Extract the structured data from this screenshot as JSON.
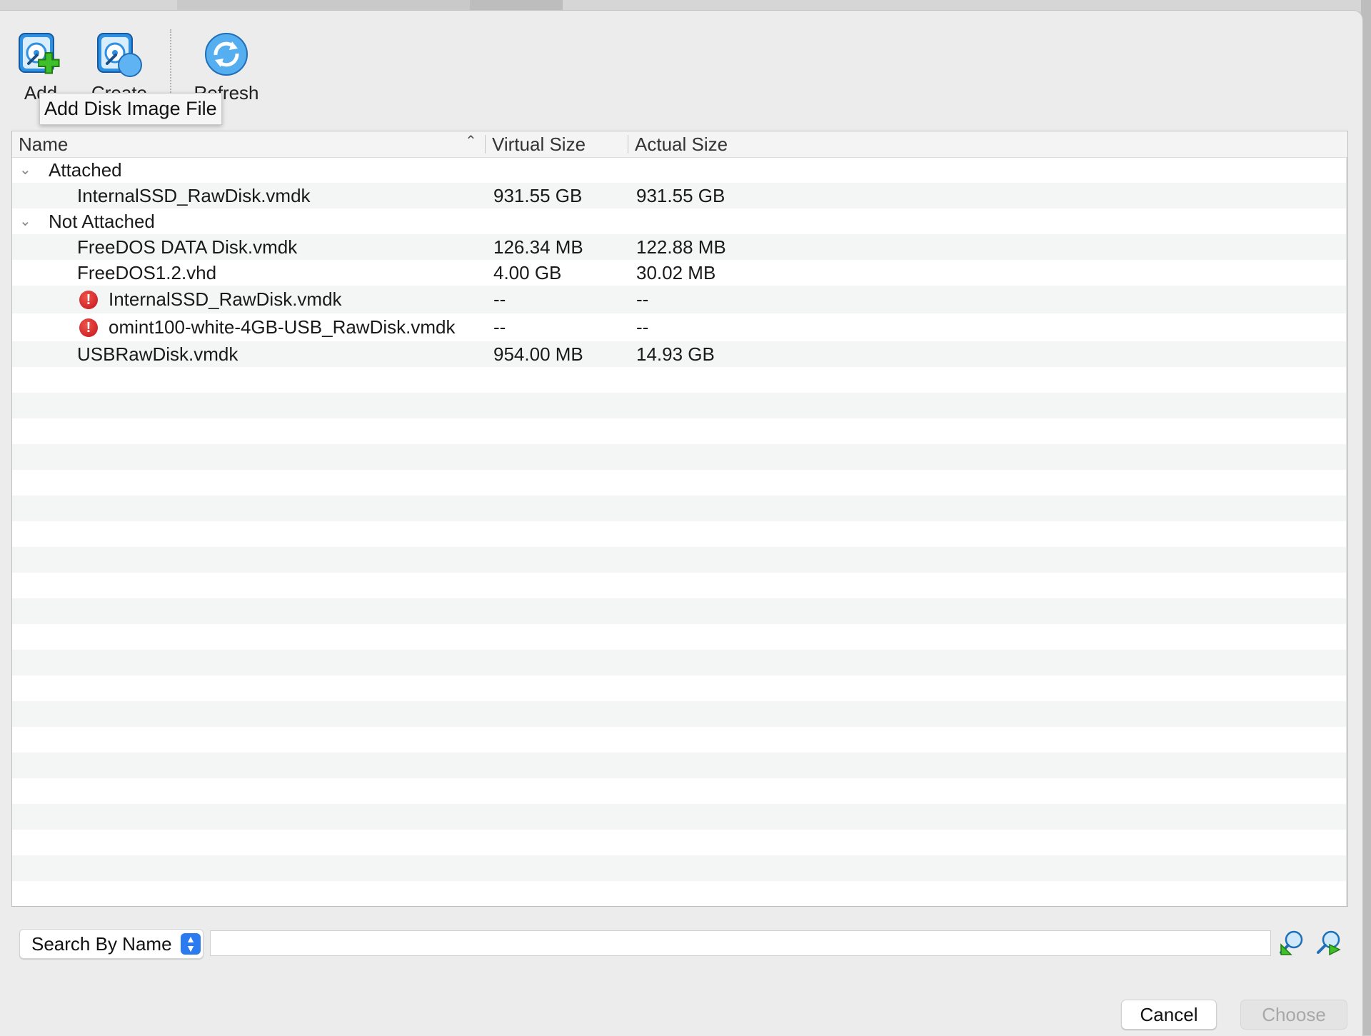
{
  "toolbar": {
    "add_label": "Add",
    "create_label": "Create",
    "refresh_label": "Refresh"
  },
  "tooltip": "Add Disk Image File",
  "table": {
    "columns": [
      "Name",
      "Virtual Size",
      "Actual Size"
    ],
    "groups": [
      {
        "label": "Attached",
        "items": [
          {
            "name": "InternalSSD_RawDisk.vmdk",
            "virtual": "931.55 GB",
            "actual": "931.55 GB",
            "error": false
          }
        ]
      },
      {
        "label": "Not Attached",
        "items": [
          {
            "name": "FreeDOS DATA Disk.vmdk",
            "virtual": "126.34 MB",
            "actual": "122.88 MB",
            "error": false
          },
          {
            "name": "FreeDOS1.2.vhd",
            "virtual": "4.00 GB",
            "actual": "30.02 MB",
            "error": false
          },
          {
            "name": "InternalSSD_RawDisk.vmdk",
            "virtual": "--",
            "actual": "--",
            "error": true
          },
          {
            "name": "omint100-white-4GB-USB_RawDisk.vmdk",
            "virtual": "--",
            "actual": "--",
            "error": true
          },
          {
            "name": "USBRawDisk.vmdk",
            "virtual": "954.00 MB",
            "actual": "14.93 GB",
            "error": false
          }
        ]
      }
    ]
  },
  "search": {
    "mode": "Search By Name",
    "value": ""
  },
  "buttons": {
    "cancel": "Cancel",
    "choose": "Choose"
  },
  "colors": {
    "accent": "#2a7bf0",
    "error": "#d01f26",
    "row_alt": "#f4f5f5"
  },
  "icons": {
    "add": "add-disk-icon",
    "create": "create-disk-icon",
    "refresh": "refresh-icon",
    "search_back": "search-backward-icon",
    "search_forward": "search-forward-icon",
    "error": "error-icon"
  }
}
